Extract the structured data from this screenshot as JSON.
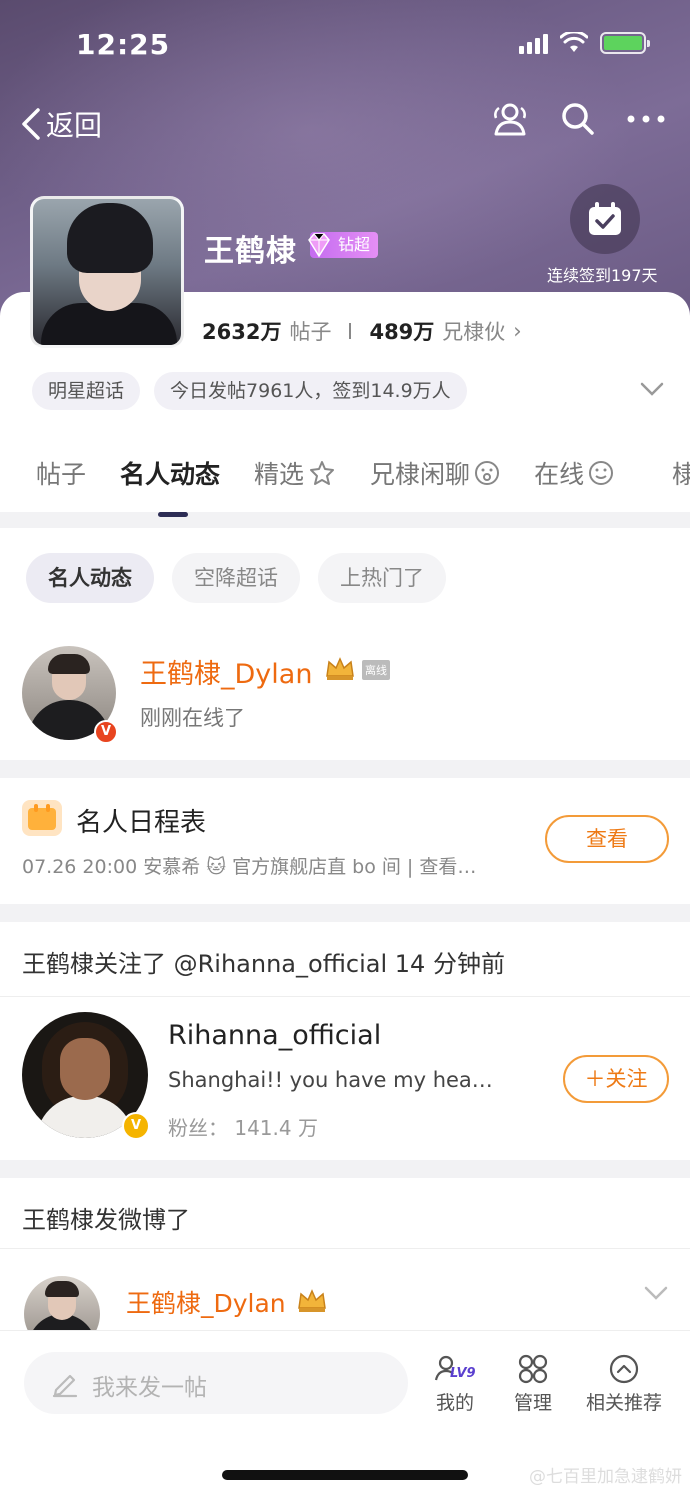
{
  "status_bar": {
    "time": "12:25"
  },
  "nav": {
    "back_label": "返回"
  },
  "profile": {
    "name": "王鹤棣",
    "badge": "钻超",
    "checkin_text": "连续签到197天",
    "posts_count": "2632万",
    "posts_label": "帖子",
    "fans_count": "489万",
    "fans_label": "兄棣伙",
    "fans_chevron": "›",
    "category_pill": "明星超话",
    "today_pill": "今日发帖7961人，签到14.9万人"
  },
  "tabs": [
    {
      "label": "帖子"
    },
    {
      "label": "名人动态"
    },
    {
      "label": "精选"
    },
    {
      "label": "兄棣闲聊"
    },
    {
      "label": "在线"
    }
  ],
  "tabs_edge_label": "棣",
  "subtabs": [
    {
      "label": "名人动态"
    },
    {
      "label": "空降超话"
    },
    {
      "label": "上热门了"
    }
  ],
  "online_card": {
    "name": "王鹤棣_Dylan",
    "tag": "离线",
    "status": "刚刚在线了",
    "verify": "V"
  },
  "schedule": {
    "title": "名人日程表",
    "desc": "07.26 20:00 安慕希 🐱 官方旗舰店直 bo 间 |  查看…",
    "button": "查看"
  },
  "follow_section": {
    "title": "王鹤棣关注了 @Rihanna_official 14 分钟前",
    "user_name": "Rihanna_official",
    "user_desc": "Shanghai!! you have my hea…",
    "fans_label": "粉丝：",
    "fans_value": "141.4 万",
    "follow_button": "＋关注",
    "verify": "V"
  },
  "post_section": {
    "title": "王鹤棣发微博了",
    "name": "王鹤棣_Dylan"
  },
  "bottom_bar": {
    "compose_placeholder": "我来发一帖",
    "mine_label": "我的",
    "level": "LV9",
    "manage_label": "管理",
    "recommend_label": "相关推荐"
  },
  "watermark": "@七百里加急逮鹤妍",
  "colors": {
    "accent_orange": "#ee6a10",
    "header_purple": "#6f5f88",
    "badge_purple": "#c46cf0"
  }
}
